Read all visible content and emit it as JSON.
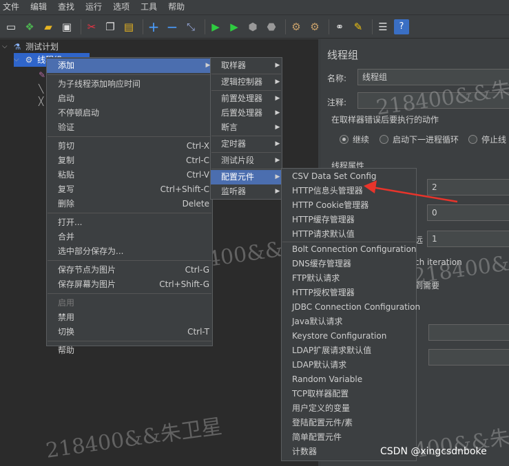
{
  "menubar": [
    "文件",
    "编辑",
    "查找",
    "运行",
    "选项",
    "工具",
    "帮助"
  ],
  "tree": {
    "root": "测试计划",
    "thread_group": "线程组"
  },
  "right_panel": {
    "title": "线程组",
    "name_label": "名称:",
    "name_value": "线程组",
    "comment_label": "注释:",
    "error_action_label": "在取样器错误后要执行的动作",
    "options": [
      "继续",
      "启动下一进程循环",
      "停止线"
    ],
    "thread_props_label": "线程属性",
    "field_values": [
      "2",
      "0",
      "1"
    ],
    "label_fragment": "远",
    "iteration_fragment": "ch iteration",
    "need_fragment": "到需要"
  },
  "context_menu": {
    "items": [
      {
        "label": "添加",
        "shortcut": "",
        "submenu": true,
        "highlight": true
      },
      {
        "sep": true
      },
      {
        "label": "为子线程添加响应时间",
        "shortcut": ""
      },
      {
        "label": "启动",
        "shortcut": ""
      },
      {
        "label": "不停顿启动",
        "shortcut": ""
      },
      {
        "label": "验证",
        "shortcut": ""
      },
      {
        "sep": true
      },
      {
        "label": "剪切",
        "shortcut": "Ctrl-X"
      },
      {
        "label": "复制",
        "shortcut": "Ctrl-C"
      },
      {
        "label": "粘贴",
        "shortcut": "Ctrl-V"
      },
      {
        "label": "复写",
        "shortcut": "Ctrl+Shift-C"
      },
      {
        "label": "删除",
        "shortcut": "Delete"
      },
      {
        "sep": true
      },
      {
        "label": "打开...",
        "shortcut": ""
      },
      {
        "label": "合并",
        "shortcut": ""
      },
      {
        "label": "选中部分保存为...",
        "shortcut": ""
      },
      {
        "sep": true
      },
      {
        "label": "保存节点为图片",
        "shortcut": "Ctrl-G"
      },
      {
        "label": "保存屏幕为图片",
        "shortcut": "Ctrl+Shift-G"
      },
      {
        "sep": true
      },
      {
        "label": "启用",
        "shortcut": "",
        "disabled": true
      },
      {
        "label": "禁用",
        "shortcut": ""
      },
      {
        "label": "切换",
        "shortcut": "Ctrl-T"
      },
      {
        "sep": true
      },
      {
        "label": "帮助",
        "shortcut": ""
      }
    ]
  },
  "add_submenu": {
    "items": [
      {
        "label": "取样器",
        "submenu": true
      },
      {
        "sep": true
      },
      {
        "label": "逻辑控制器",
        "submenu": true
      },
      {
        "sep": true
      },
      {
        "label": "前置处理器",
        "submenu": true
      },
      {
        "label": "后置处理器",
        "submenu": true
      },
      {
        "label": "断言",
        "submenu": true
      },
      {
        "sep": true
      },
      {
        "label": "定时器",
        "submenu": true
      },
      {
        "sep": true
      },
      {
        "label": "测试片段",
        "submenu": true
      },
      {
        "sep": true
      },
      {
        "label": "配置元件",
        "submenu": true,
        "highlight": true
      },
      {
        "label": "监听器",
        "submenu": true
      }
    ]
  },
  "config_submenu": {
    "items": [
      {
        "label": "CSV Data Set Config"
      },
      {
        "label": "HTTP信息头管理器"
      },
      {
        "label": "HTTP Cookie管理器"
      },
      {
        "label": "HTTP缓存管理器"
      },
      {
        "label": "HTTP请求默认值"
      },
      {
        "sep": true
      },
      {
        "label": "Bolt Connection Configuration"
      },
      {
        "label": "DNS缓存管理器"
      },
      {
        "label": "FTP默认请求"
      },
      {
        "label": "HTTP授权管理器"
      },
      {
        "label": "JDBC Connection Configuration"
      },
      {
        "label": "Java默认请求"
      },
      {
        "label": "Keystore Configuration"
      },
      {
        "label": "LDAP扩展请求默认值"
      },
      {
        "label": "LDAP默认请求"
      },
      {
        "label": "Random Variable"
      },
      {
        "label": "TCP取样器配置"
      },
      {
        "label": "用户定义的变量"
      },
      {
        "label": "登陆配置元件/素"
      },
      {
        "label": "简单配置元件"
      },
      {
        "label": "计数器"
      }
    ]
  },
  "watermarks": [
    "218400&&朱",
    "218400&&朱卫星",
    "218400&&朱",
    "218400&&朱卫星",
    "400&&朱"
  ],
  "credit": "CSDN @xingcsdnboke",
  "colors": {
    "highlight": "#4b6eaf",
    "arrow": "#e8342b"
  }
}
